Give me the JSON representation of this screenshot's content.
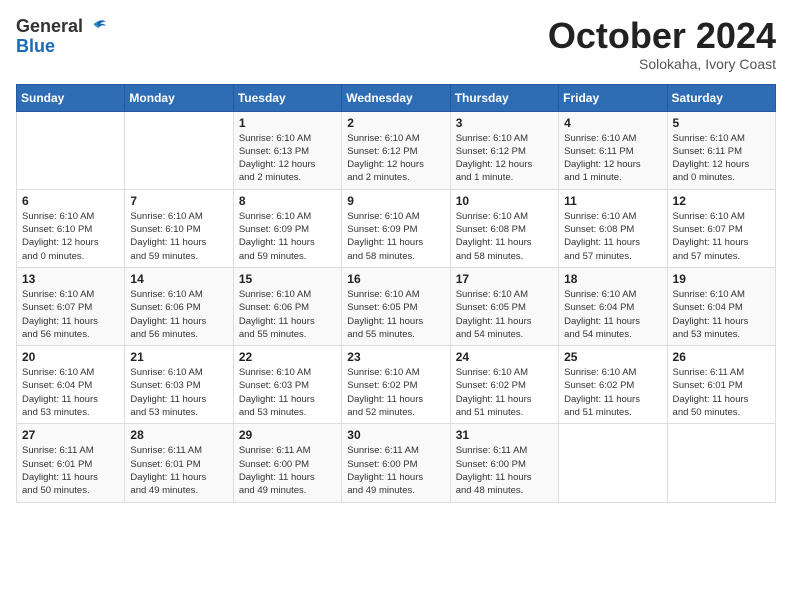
{
  "header": {
    "logo": {
      "general": "General",
      "blue": "Blue",
      "tagline": "GeneralBlue"
    },
    "title": "October 2024",
    "location": "Solokaha, Ivory Coast"
  },
  "weekdays": [
    "Sunday",
    "Monday",
    "Tuesday",
    "Wednesday",
    "Thursday",
    "Friday",
    "Saturday"
  ],
  "weeks": [
    [
      {
        "day": "",
        "info": ""
      },
      {
        "day": "",
        "info": ""
      },
      {
        "day": "1",
        "info": "Sunrise: 6:10 AM\nSunset: 6:13 PM\nDaylight: 12 hours\nand 2 minutes."
      },
      {
        "day": "2",
        "info": "Sunrise: 6:10 AM\nSunset: 6:12 PM\nDaylight: 12 hours\nand 2 minutes."
      },
      {
        "day": "3",
        "info": "Sunrise: 6:10 AM\nSunset: 6:12 PM\nDaylight: 12 hours\nand 1 minute."
      },
      {
        "day": "4",
        "info": "Sunrise: 6:10 AM\nSunset: 6:11 PM\nDaylight: 12 hours\nand 1 minute."
      },
      {
        "day": "5",
        "info": "Sunrise: 6:10 AM\nSunset: 6:11 PM\nDaylight: 12 hours\nand 0 minutes."
      }
    ],
    [
      {
        "day": "6",
        "info": "Sunrise: 6:10 AM\nSunset: 6:10 PM\nDaylight: 12 hours\nand 0 minutes."
      },
      {
        "day": "7",
        "info": "Sunrise: 6:10 AM\nSunset: 6:10 PM\nDaylight: 11 hours\nand 59 minutes."
      },
      {
        "day": "8",
        "info": "Sunrise: 6:10 AM\nSunset: 6:09 PM\nDaylight: 11 hours\nand 59 minutes."
      },
      {
        "day": "9",
        "info": "Sunrise: 6:10 AM\nSunset: 6:09 PM\nDaylight: 11 hours\nand 58 minutes."
      },
      {
        "day": "10",
        "info": "Sunrise: 6:10 AM\nSunset: 6:08 PM\nDaylight: 11 hours\nand 58 minutes."
      },
      {
        "day": "11",
        "info": "Sunrise: 6:10 AM\nSunset: 6:08 PM\nDaylight: 11 hours\nand 57 minutes."
      },
      {
        "day": "12",
        "info": "Sunrise: 6:10 AM\nSunset: 6:07 PM\nDaylight: 11 hours\nand 57 minutes."
      }
    ],
    [
      {
        "day": "13",
        "info": "Sunrise: 6:10 AM\nSunset: 6:07 PM\nDaylight: 11 hours\nand 56 minutes."
      },
      {
        "day": "14",
        "info": "Sunrise: 6:10 AM\nSunset: 6:06 PM\nDaylight: 11 hours\nand 56 minutes."
      },
      {
        "day": "15",
        "info": "Sunrise: 6:10 AM\nSunset: 6:06 PM\nDaylight: 11 hours\nand 55 minutes."
      },
      {
        "day": "16",
        "info": "Sunrise: 6:10 AM\nSunset: 6:05 PM\nDaylight: 11 hours\nand 55 minutes."
      },
      {
        "day": "17",
        "info": "Sunrise: 6:10 AM\nSunset: 6:05 PM\nDaylight: 11 hours\nand 54 minutes."
      },
      {
        "day": "18",
        "info": "Sunrise: 6:10 AM\nSunset: 6:04 PM\nDaylight: 11 hours\nand 54 minutes."
      },
      {
        "day": "19",
        "info": "Sunrise: 6:10 AM\nSunset: 6:04 PM\nDaylight: 11 hours\nand 53 minutes."
      }
    ],
    [
      {
        "day": "20",
        "info": "Sunrise: 6:10 AM\nSunset: 6:04 PM\nDaylight: 11 hours\nand 53 minutes."
      },
      {
        "day": "21",
        "info": "Sunrise: 6:10 AM\nSunset: 6:03 PM\nDaylight: 11 hours\nand 53 minutes."
      },
      {
        "day": "22",
        "info": "Sunrise: 6:10 AM\nSunset: 6:03 PM\nDaylight: 11 hours\nand 53 minutes."
      },
      {
        "day": "23",
        "info": "Sunrise: 6:10 AM\nSunset: 6:02 PM\nDaylight: 11 hours\nand 52 minutes."
      },
      {
        "day": "24",
        "info": "Sunrise: 6:10 AM\nSunset: 6:02 PM\nDaylight: 11 hours\nand 51 minutes."
      },
      {
        "day": "25",
        "info": "Sunrise: 6:10 AM\nSunset: 6:02 PM\nDaylight: 11 hours\nand 51 minutes."
      },
      {
        "day": "26",
        "info": "Sunrise: 6:11 AM\nSunset: 6:01 PM\nDaylight: 11 hours\nand 50 minutes."
      }
    ],
    [
      {
        "day": "27",
        "info": "Sunrise: 6:11 AM\nSunset: 6:01 PM\nDaylight: 11 hours\nand 50 minutes."
      },
      {
        "day": "28",
        "info": "Sunrise: 6:11 AM\nSunset: 6:01 PM\nDaylight: 11 hours\nand 49 minutes."
      },
      {
        "day": "29",
        "info": "Sunrise: 6:11 AM\nSunset: 6:00 PM\nDaylight: 11 hours\nand 49 minutes."
      },
      {
        "day": "30",
        "info": "Sunrise: 6:11 AM\nSunset: 6:00 PM\nDaylight: 11 hours\nand 49 minutes."
      },
      {
        "day": "31",
        "info": "Sunrise: 6:11 AM\nSunset: 6:00 PM\nDaylight: 11 hours\nand 48 minutes."
      },
      {
        "day": "",
        "info": ""
      },
      {
        "day": "",
        "info": ""
      }
    ]
  ]
}
